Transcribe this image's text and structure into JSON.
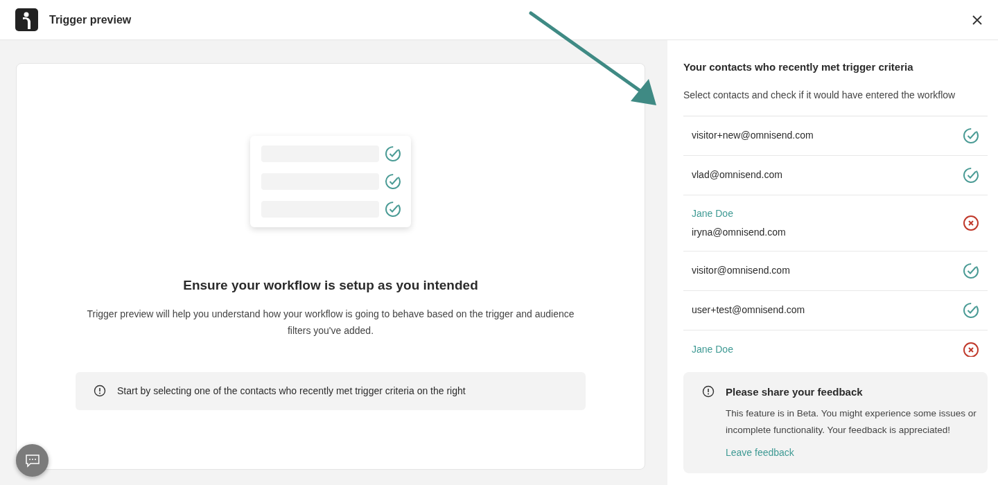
{
  "window": {
    "title": "Trigger preview"
  },
  "intro": {
    "illustration_rows": [
      {
        "checked": true
      },
      {
        "checked": true
      },
      {
        "checked": true
      }
    ],
    "heading": "Ensure your workflow is setup as you intended",
    "text": "Trigger preview will help you understand how your workflow is going to behave based on the trigger and audience filters you've added.",
    "hint": "Start by selecting one of the contacts who recently met trigger criteria on the right"
  },
  "contacts_panel": {
    "title": "Your contacts who recently met trigger criteria",
    "subtitle": "Select contacts and check if it would have entered the workflow",
    "contacts": [
      {
        "email": "visitor+new@omnisend.com",
        "entered": true
      },
      {
        "email": "vlad@omnisend.com",
        "entered": true
      },
      {
        "name": "Jane Doe",
        "email": "iryna@omnisend.com",
        "entered": false
      },
      {
        "email": "visitor@omnisend.com",
        "entered": true
      },
      {
        "email": "user+test@omnisend.com",
        "entered": true
      },
      {
        "name": "Jane Doe",
        "entered": false
      }
    ]
  },
  "feedback": {
    "title": "Please share your feedback",
    "text": "This feature is in Beta. You might experience some issues or incomplete functionality. Your feedback is appreciated!",
    "link": "Leave feedback"
  }
}
